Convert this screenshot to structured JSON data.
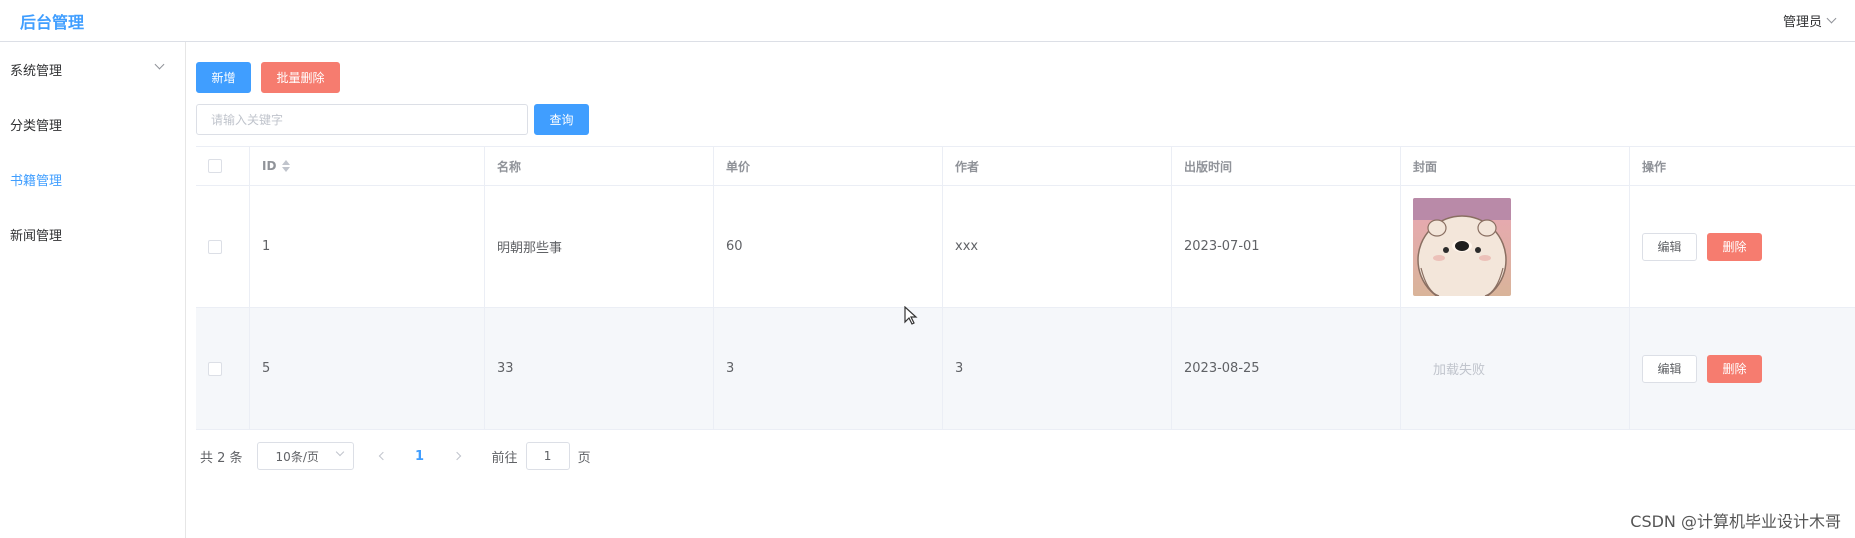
{
  "header": {
    "title": "后台管理",
    "user": "管理员"
  },
  "sidebar": {
    "items": [
      {
        "label": "系统管理",
        "has_arrow": true
      },
      {
        "label": "分类管理"
      },
      {
        "label": "书籍管理",
        "active": true
      },
      {
        "label": "新闻管理"
      }
    ]
  },
  "toolbar": {
    "add_label": "新增",
    "batch_delete_label": "批量删除",
    "search_button": "查询"
  },
  "search": {
    "placeholder": "请输入关键字",
    "value": ""
  },
  "table": {
    "columns": [
      "ID",
      "名称",
      "单价",
      "作者",
      "出版时间",
      "封面",
      "操作"
    ],
    "rows": [
      {
        "id": "1",
        "name": "明朝那些事",
        "price": "60",
        "author": "xxx",
        "date": "2023-07-01",
        "cover": "image",
        "cover_text": ""
      },
      {
        "id": "5",
        "name": "33",
        "price": "3",
        "author": "3",
        "date": "2023-08-25",
        "cover": "failed",
        "cover_text": "加载失败"
      }
    ],
    "edit_label": "编辑",
    "delete_label": "删除"
  },
  "pagination": {
    "total": "共 2 条",
    "page_size": "10条/页",
    "current_page": "1",
    "goto_label": "前往",
    "goto_value": "1",
    "page_suffix": "页"
  },
  "watermark": "CSDN @计算机毕业设计木哥",
  "colors": {
    "primary": "#409eff",
    "danger": "#f67c6f"
  }
}
